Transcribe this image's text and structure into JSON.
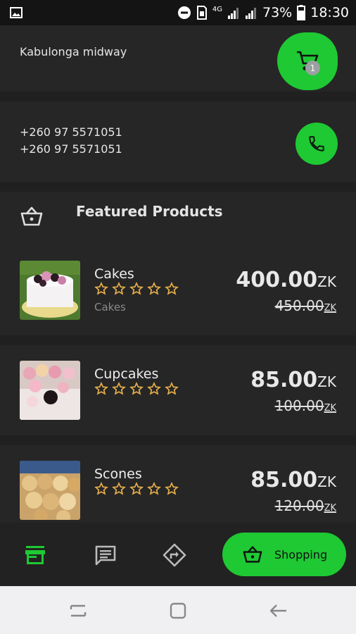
{
  "status_bar": {
    "network_type": "4G",
    "battery_percent": "73%",
    "time": "18:30"
  },
  "store": {
    "address": "Kabulonga midway",
    "phones": [
      "+260 97 5571051",
      "+260 97 5571051"
    ],
    "cart_count": "1"
  },
  "featured": {
    "title": "Featured Products"
  },
  "products": [
    {
      "name": "Cakes",
      "category": "Cakes",
      "rating": 0,
      "price": "400.00",
      "currency": "ZK",
      "old_price": "450.00",
      "old_currency": "ZK"
    },
    {
      "name": "Cupcakes",
      "category": "",
      "rating": 0,
      "price": "85.00",
      "currency": "ZK",
      "old_price": "100.00",
      "old_currency": "ZK"
    },
    {
      "name": "Scones",
      "category": "",
      "rating": 0,
      "price": "85.00",
      "currency": "ZK",
      "old_price": "120.00",
      "old_currency": "ZK"
    }
  ],
  "bottom_nav": {
    "items": [
      "store-icon",
      "chat-icon",
      "directions-icon"
    ],
    "shopping_label": "Shopping"
  },
  "colors": {
    "accent": "#1ec933",
    "background": "#202020",
    "card": "#262626",
    "star": "#e8b04a"
  }
}
